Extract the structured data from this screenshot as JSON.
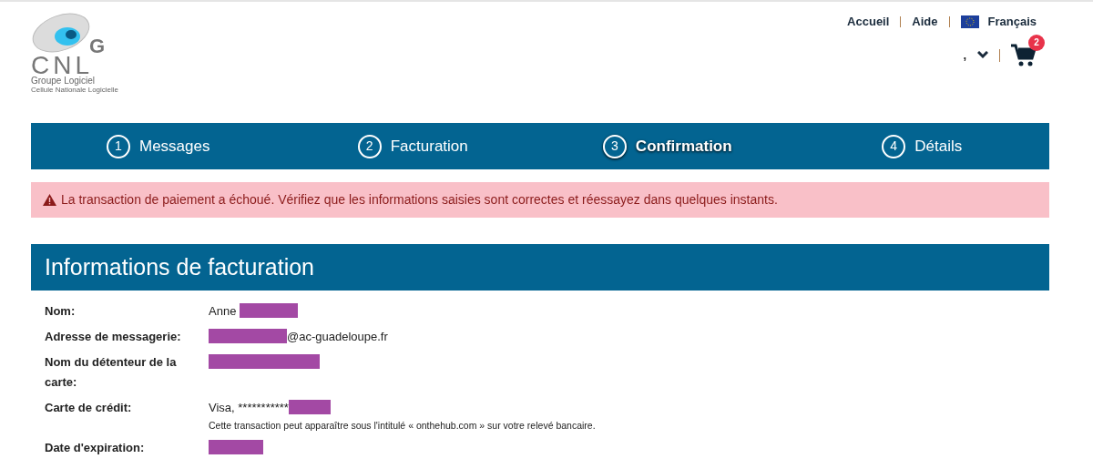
{
  "logo": {
    "letters": "CNL",
    "badge_letter": "G",
    "name": "Groupe Logiciel",
    "tagline": "Cellule Nationale Logicielle"
  },
  "top_links": [
    {
      "kind": "link",
      "label": "Accueil"
    },
    {
      "kind": "link",
      "label": "Aide"
    },
    {
      "kind": "language",
      "label": "Français"
    }
  ],
  "user_menu": {
    "label": ","
  },
  "cart": {
    "count": "2"
  },
  "steps": [
    {
      "number": "1",
      "label": "Messages",
      "selected": false
    },
    {
      "number": "2",
      "label": "Facturation",
      "selected": false
    },
    {
      "number": "3",
      "label": "Confirmation",
      "selected": true
    },
    {
      "number": "4",
      "label": "Détails",
      "selected": false
    }
  ],
  "alert": {
    "text": "La transaction de paiement a échoué. Vérifiez que les informations saisies sont correctes et réessayez dans quelques instants."
  },
  "section": {
    "title": "Informations de facturation"
  },
  "fields": [
    {
      "label": "Nom:",
      "value": [
        {
          "kind": "text",
          "text": "Anne "
        },
        {
          "kind": "redacted"
        }
      ]
    },
    {
      "label": "Adresse de messagerie:",
      "value": [
        {
          "kind": "redacted"
        },
        {
          "kind": "text",
          "text": "@ac-guadeloupe.fr"
        }
      ]
    },
    {
      "label": "Nom du détenteur de la carte:",
      "value": [
        {
          "kind": "redacted"
        }
      ]
    },
    {
      "label": "Carte de crédit:",
      "value": [
        {
          "kind": "text",
          "text": "Visa, ***********"
        },
        {
          "kind": "redacted"
        }
      ],
      "note": "Cette transaction peut apparaître sous l'intitulé « onthehub.com » sur votre relevé bancaire."
    },
    {
      "label": "Date d'expiration:",
      "value": [
        {
          "kind": "redacted"
        }
      ]
    }
  ]
}
